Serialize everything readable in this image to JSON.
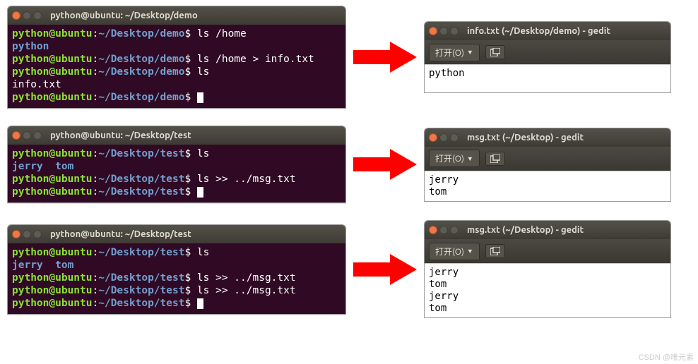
{
  "rows": [
    {
      "terminal": {
        "title": "python@ubuntu: ~/Desktop/demo",
        "prompt_user": "python@ubuntu",
        "prompt_path": "~/Desktop/demo",
        "lines": [
          {
            "type": "cmd",
            "cmd": "ls /home"
          },
          {
            "type": "out-blue",
            "text": "python"
          },
          {
            "type": "cmd",
            "cmd": "ls /home > info.txt"
          },
          {
            "type": "cmd",
            "cmd": "ls"
          },
          {
            "type": "out-white",
            "text": "info.txt"
          },
          {
            "type": "cmd",
            "cmd": "",
            "cursor": true
          }
        ]
      },
      "gedit": {
        "title": "info.txt (~/Desktop/demo) - gedit",
        "open_label": "打开(O)",
        "content": [
          "python"
        ]
      }
    },
    {
      "terminal": {
        "title": "python@ubuntu: ~/Desktop/test",
        "prompt_user": "python@ubuntu",
        "prompt_path": "~/Desktop/test",
        "lines": [
          {
            "type": "cmd",
            "cmd": "ls"
          },
          {
            "type": "out-blue",
            "text": "jerry  tom"
          },
          {
            "type": "cmd",
            "cmd": "ls >> ../msg.txt"
          },
          {
            "type": "cmd",
            "cmd": "",
            "cursor": true
          }
        ]
      },
      "gedit": {
        "title": "msg.txt (~/Desktop) - gedit",
        "open_label": "打开(O)",
        "content": [
          "jerry",
          "tom"
        ]
      }
    },
    {
      "terminal": {
        "title": "python@ubuntu: ~/Desktop/test",
        "prompt_user": "python@ubuntu",
        "prompt_path": "~/Desktop/test",
        "lines": [
          {
            "type": "cmd",
            "cmd": "ls"
          },
          {
            "type": "out-blue",
            "text": "jerry  tom"
          },
          {
            "type": "cmd",
            "cmd": "ls >> ../msg.txt"
          },
          {
            "type": "cmd",
            "cmd": "ls >> ../msg.txt"
          },
          {
            "type": "cmd",
            "cmd": "",
            "cursor": true
          }
        ]
      },
      "gedit": {
        "title": "msg.txt (~/Desktop) - gedit",
        "open_label": "打开(O)",
        "content": [
          "jerry",
          "tom",
          "jerry",
          "tom"
        ]
      }
    }
  ],
  "watermark": "CSDN @唯元素"
}
